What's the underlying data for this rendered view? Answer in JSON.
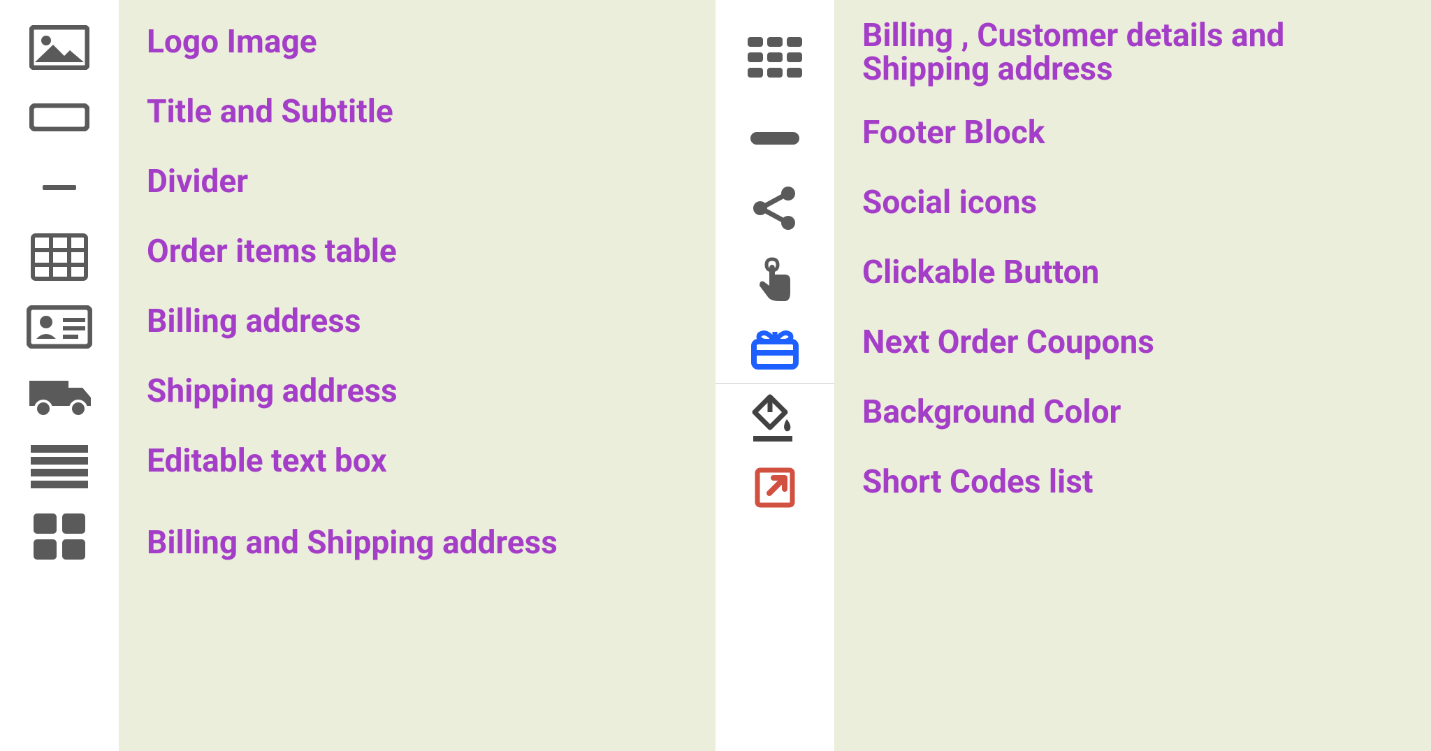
{
  "left": {
    "items": [
      {
        "icon": "image",
        "label": "Logo Image"
      },
      {
        "icon": "title",
        "label": "Title and Subtitle"
      },
      {
        "icon": "divider",
        "label": "Divider"
      },
      {
        "icon": "table",
        "label": "Order items table"
      },
      {
        "icon": "id-card",
        "label": "Billing address"
      },
      {
        "icon": "truck",
        "label": "Shipping address"
      },
      {
        "icon": "text-lines",
        "label": "Editable text box"
      },
      {
        "icon": "grid-2x2",
        "label": "Billing and Shipping address"
      }
    ]
  },
  "right": {
    "items": [
      {
        "icon": "grid-3x3",
        "label": "Billing , Customer details and Shipping address"
      },
      {
        "icon": "footer",
        "label": "Footer Block"
      },
      {
        "icon": "share",
        "label": "Social icons"
      },
      {
        "icon": "tap",
        "label": "Clickable Button"
      },
      {
        "icon": "gift",
        "label": "Next Order Coupons"
      },
      {
        "icon": "paint",
        "label": "Background Color"
      },
      {
        "icon": "external",
        "label": "Short Codes list"
      }
    ]
  },
  "colors": {
    "label": "#a43ec8",
    "iconGray": "#5a5a5a",
    "iconBlue": "#1d5fff",
    "iconRed": "#d15040"
  }
}
